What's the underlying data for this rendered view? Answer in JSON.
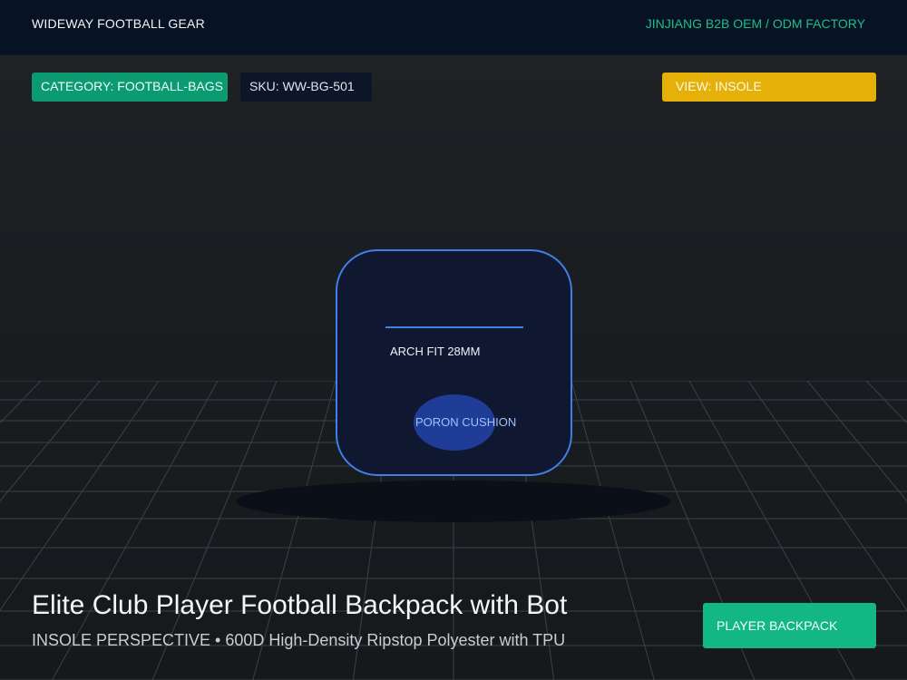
{
  "header": {
    "brand": "WIDEWAY FOOTBALL GEAR",
    "factory": "JINJIANG B2B OEM / ODM FACTORY"
  },
  "badges": {
    "category": "CATEGORY: FOOTBALL-BAGS",
    "sku": "SKU: WW-BG-501",
    "view": "VIEW: INSOLE"
  },
  "product": {
    "arch_label": "ARCH FIT 28MM",
    "cushion_label": "PORON CUSHION"
  },
  "footer": {
    "title": "Elite Club Player Football Backpack with Bot",
    "subtitle": "INSOLE PERSPECTIVE • 600D High-Density Ripstop Polyester with TPU",
    "cta_label": "PLAYER BACKPACK"
  },
  "colors": {
    "header_bg": "#071224",
    "accent_green": "#12b784",
    "accent_yellow": "#e5b00a",
    "product_outline": "#3f7fe6",
    "grid_line": "#3a4148"
  }
}
